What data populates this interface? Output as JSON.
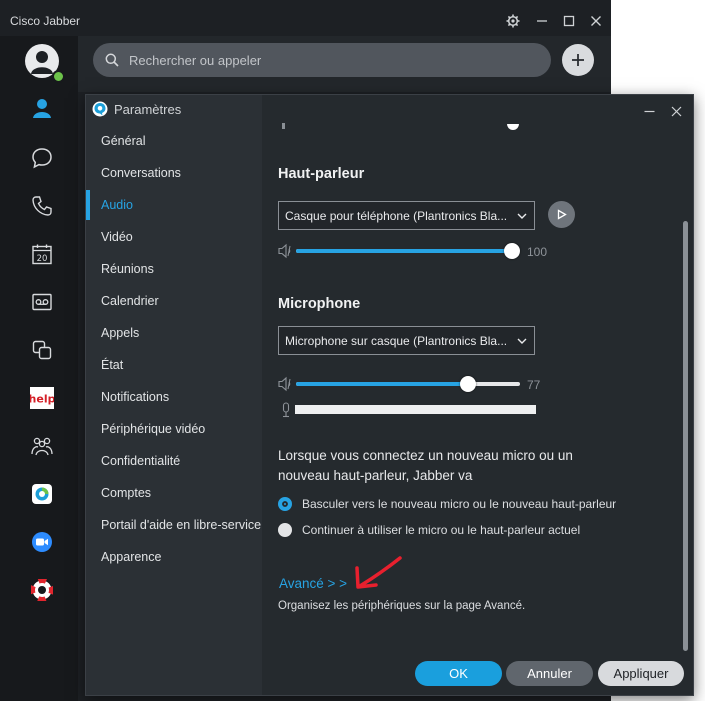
{
  "app": {
    "title": "Cisco Jabber"
  },
  "search": {
    "placeholder": "Rechercher ou appeler"
  },
  "rail": {
    "calendar_day": "20",
    "help_label": "help"
  },
  "settings": {
    "title": "Paramètres",
    "nav": [
      {
        "label": "Général"
      },
      {
        "label": "Conversations"
      },
      {
        "label": "Audio",
        "active": true
      },
      {
        "label": "Vidéo"
      },
      {
        "label": "Réunions"
      },
      {
        "label": "Calendrier"
      },
      {
        "label": "Appels"
      },
      {
        "label": "État"
      },
      {
        "label": "Notifications"
      },
      {
        "label": "Périphérique vidéo"
      },
      {
        "label": "Confidentialité"
      },
      {
        "label": "Comptes"
      },
      {
        "label": "Portail d'aide en libre-service"
      },
      {
        "label": "Apparence"
      }
    ],
    "speaker": {
      "heading": "Haut-parleur",
      "device": "Casque pour téléphone (Plantronics Bla...",
      "volume": 100,
      "volume_label": "100"
    },
    "microphone": {
      "heading": "Microphone",
      "device": "Microphone sur casque (Plantronics Bla...",
      "volume": 77,
      "volume_label": "77"
    },
    "new_device": {
      "text": "Lorsque vous connectez un nouveau micro ou un nouveau haut-parleur, Jabber va",
      "options": [
        {
          "label": "Basculer vers le nouveau micro ou le nouveau haut-parleur",
          "selected": true
        },
        {
          "label": "Continuer à utiliser le micro ou le haut-parleur actuel",
          "selected": false
        }
      ]
    },
    "advanced": {
      "link": "Avancé > >",
      "description": "Organisez les périphériques sur la page Avancé."
    },
    "buttons": {
      "ok": "OK",
      "cancel": "Annuler",
      "apply": "Appliquer"
    }
  },
  "colors": {
    "accent": "#27a3e3",
    "presence": "#6cc24a",
    "annotation_arrow": "#e8202e"
  }
}
